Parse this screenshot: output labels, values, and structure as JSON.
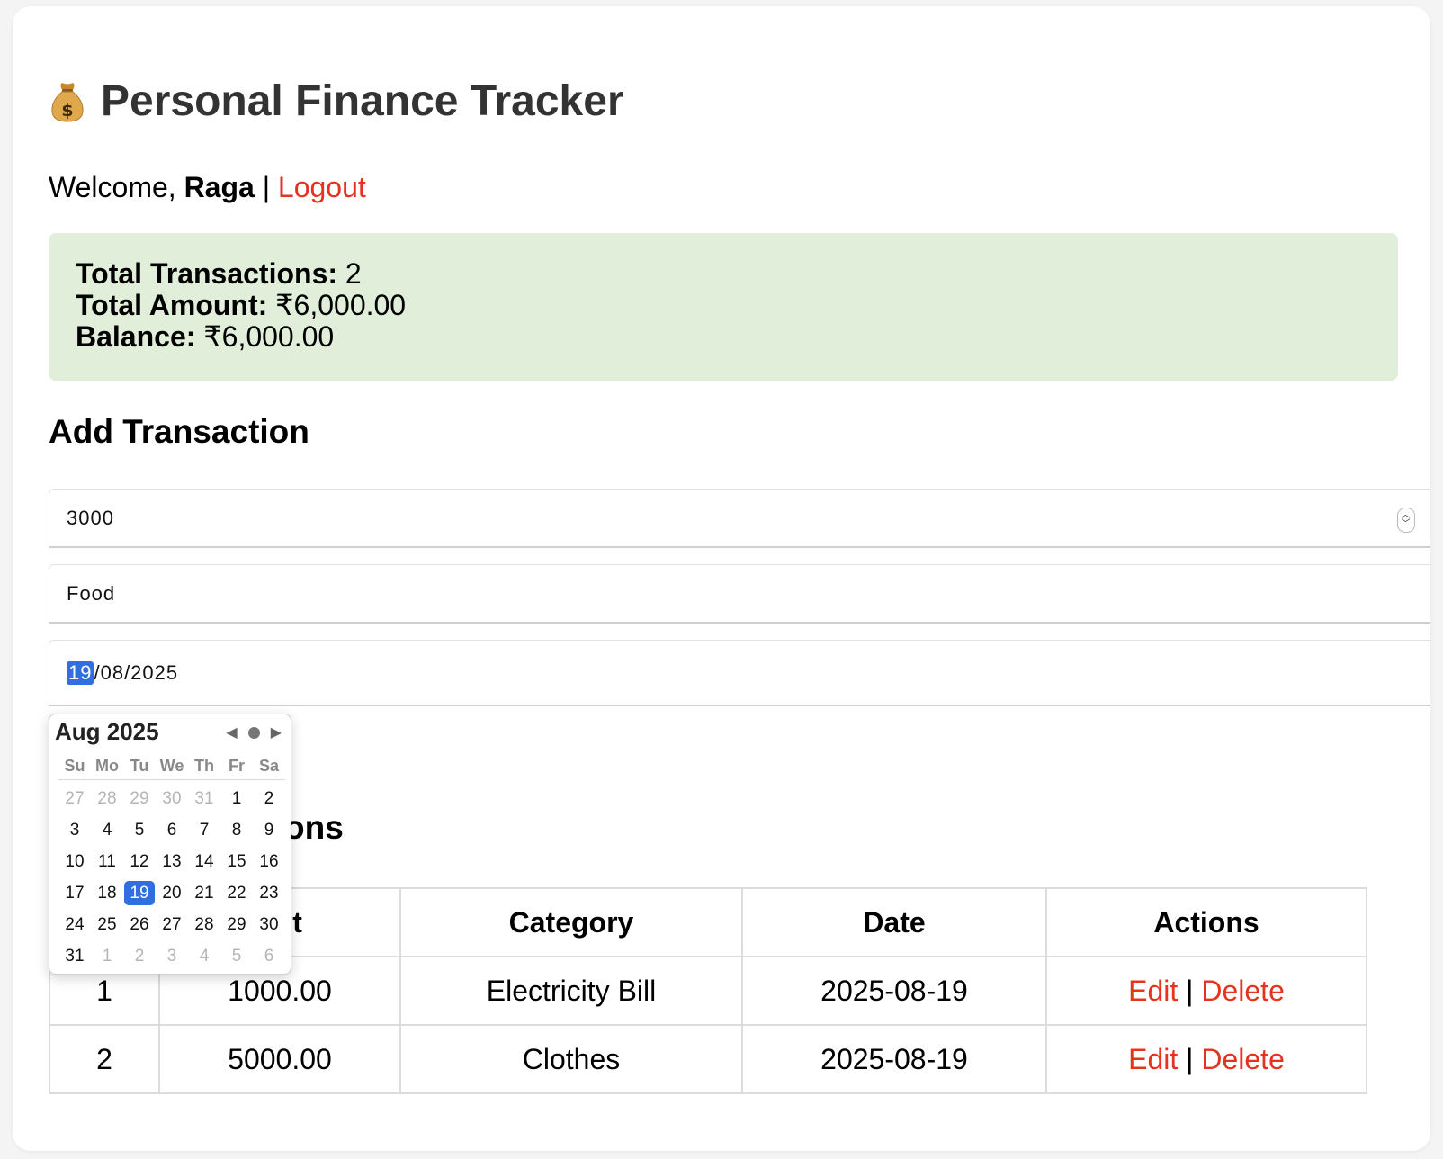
{
  "app": {
    "icon": "money-bag-icon",
    "title": "Personal Finance Tracker"
  },
  "welcome": {
    "prefix": "Welcome, ",
    "username": "Raga",
    "separator": " | ",
    "logout_label": "Logout"
  },
  "summary": {
    "total_transactions_label": "Total Transactions:",
    "total_transactions_value": "2",
    "total_amount_label": "Total Amount:",
    "total_amount_value": "₹6,000.00",
    "balance_label": "Balance:",
    "balance_value": "₹6,000.00"
  },
  "add_form": {
    "heading": "Add Transaction",
    "amount_value": "3000",
    "category_value": "Food",
    "date_day": "19",
    "date_rest": "/08/2025"
  },
  "datepicker": {
    "month_label": "Aug 2025",
    "prev_icon": "◀",
    "next_icon": "▶",
    "weekdays": [
      "Su",
      "Mo",
      "Tu",
      "We",
      "Th",
      "Fr",
      "Sa"
    ],
    "weeks": [
      [
        "27",
        "28",
        "29",
        "30",
        "31",
        "1",
        "2"
      ],
      [
        "3",
        "4",
        "5",
        "6",
        "7",
        "8",
        "9"
      ],
      [
        "10",
        "11",
        "12",
        "13",
        "14",
        "15",
        "16"
      ],
      [
        "17",
        "18",
        "19",
        "20",
        "21",
        "22",
        "23"
      ],
      [
        "24",
        "25",
        "26",
        "27",
        "28",
        "29",
        "30"
      ],
      [
        "31",
        "1",
        "2",
        "3",
        "4",
        "5",
        "6"
      ]
    ],
    "selected_day": "19"
  },
  "transactions": {
    "heading_visible": "ons",
    "columns": [
      "",
      "unt",
      "Category",
      "Date",
      "Actions"
    ],
    "rows": [
      {
        "id": "1",
        "amount": "1000.00",
        "category": "Electricity Bill",
        "date": "2025-08-19"
      },
      {
        "id": "2",
        "amount": "5000.00",
        "category": "Clothes",
        "date": "2025-08-19"
      }
    ],
    "edit_label": "Edit",
    "action_separator": " | ",
    "delete_label": "Delete"
  },
  "colors": {
    "accent_red": "#e53320",
    "accent_blue": "#2f6fe0",
    "summary_bg": "#e1eed9",
    "title_color": "#333333"
  }
}
